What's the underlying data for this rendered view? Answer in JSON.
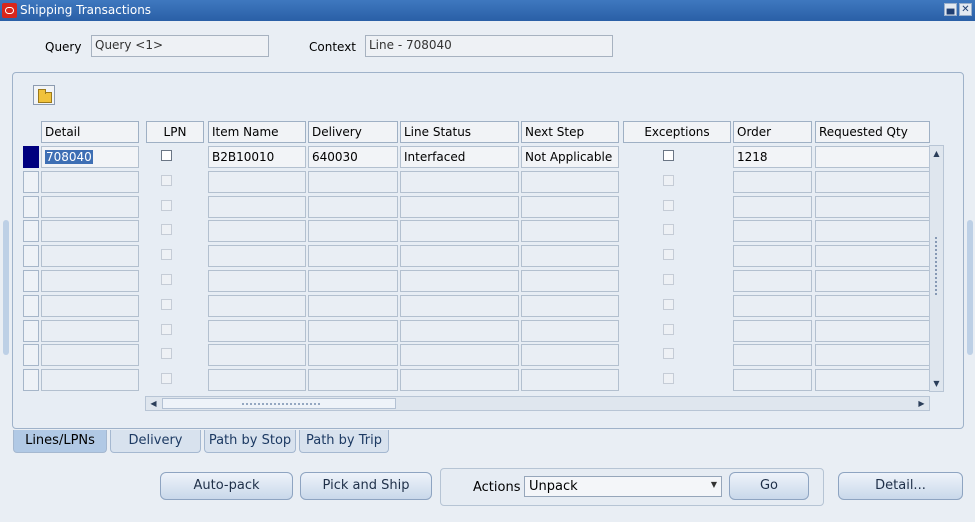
{
  "window": {
    "title": "Shipping Transactions",
    "minimize": "▄",
    "close": "✕"
  },
  "query": {
    "label": "Query",
    "value": "Query <1>"
  },
  "context": {
    "label": "Context",
    "value": "Line - 708040"
  },
  "toolbar": {
    "icon": "folder-open-icon"
  },
  "table": {
    "columns": [
      "Detail",
      "LPN",
      "Item Name",
      "Delivery",
      "Line Status",
      "Next Step",
      "Exceptions",
      "Order",
      "Requested Qty"
    ],
    "rows": [
      {
        "detail": "708040",
        "item_name": "B2B10010",
        "delivery": "640030",
        "line_status": "Interfaced",
        "next_step": "Not Applicable",
        "order": "1218",
        "requested_qty": ""
      }
    ],
    "total_visible_rows": 10
  },
  "scroll": {
    "up": "▲",
    "down": "▼",
    "left": "◀",
    "right": "▶"
  },
  "tabs": [
    {
      "label": "Lines/LPNs",
      "active": true
    },
    {
      "label": "Delivery",
      "active": false
    },
    {
      "label": "Path by Stop",
      "active": false
    },
    {
      "label": "Path by Trip",
      "active": false
    }
  ],
  "buttons": {
    "auto_pack": "Auto-pack",
    "pick_and_ship": "Pick and Ship",
    "go": "Go",
    "detail": "Detail..."
  },
  "actions": {
    "label": "Actions",
    "selected": "Unpack",
    "arrow": "▼"
  },
  "colors": {
    "titlebar": "#2a5fa6",
    "current_row": "#00007f",
    "selection": "#3e6fb4"
  }
}
